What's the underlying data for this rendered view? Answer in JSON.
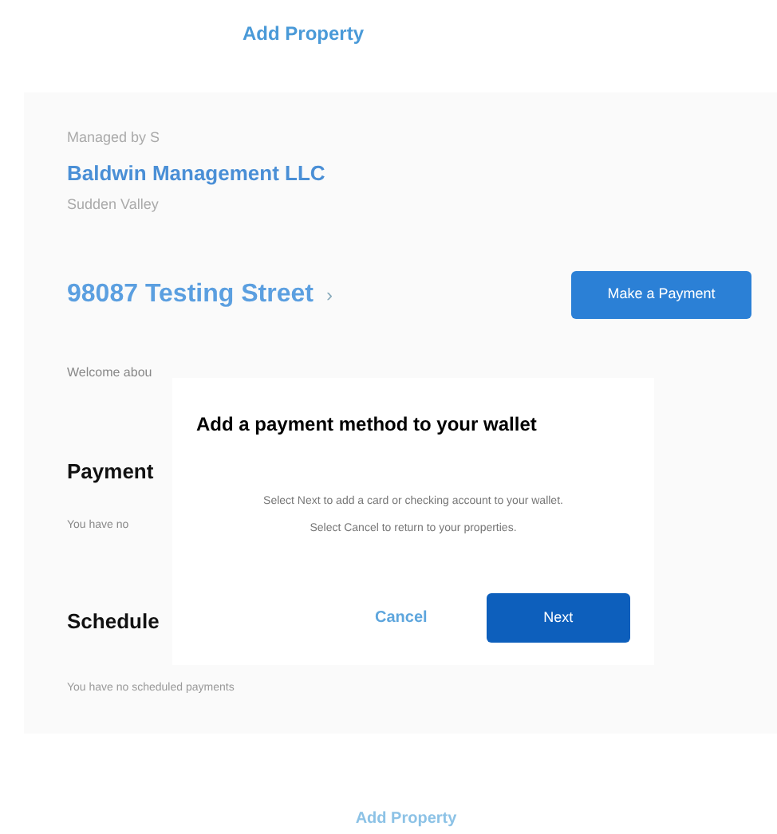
{
  "top_link": "Add Property",
  "property": {
    "managed_by": "Managed by S",
    "manager": "Baldwin Management LLC",
    "community": "Sudden Valley",
    "address": "98087 Testing Street",
    "address_caret": "›",
    "pay_button": "Make a Payment",
    "welcome": "Welcome abou"
  },
  "sections": [
    {
      "heading": "Payment",
      "note": "You have no"
    },
    {
      "heading": "Schedule",
      "note": "You have no scheduled payments"
    }
  ],
  "dialog": {
    "title": "Add a payment method to your wallet",
    "lines": [
      "Select Next to add a card or checking account to your wallet.",
      "Select Cancel to return to your properties."
    ],
    "cancel": "Cancel",
    "next": "Next"
  },
  "bottom_link": "Add Property"
}
